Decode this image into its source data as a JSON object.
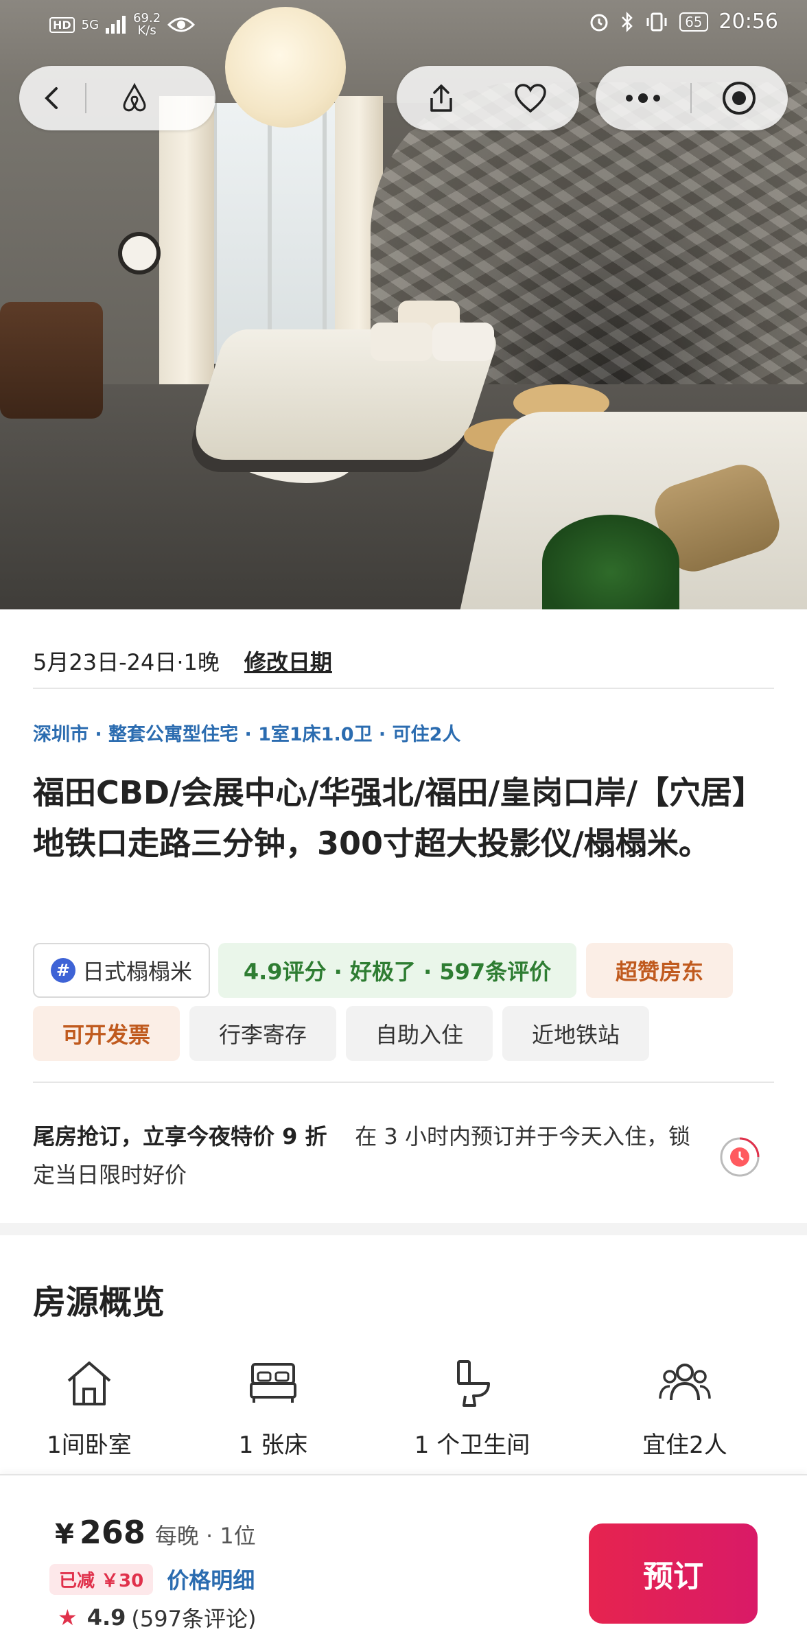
{
  "status_bar": {
    "network": "HD",
    "signal": "5G",
    "speed_value": "69.2",
    "speed_unit": "K/s",
    "battery": "65",
    "time": "20:56"
  },
  "nav": {
    "back_icon": "chevron-left-icon",
    "brand_icon": "airbnb-logo-icon",
    "share_icon": "share-icon",
    "favorite_icon": "heart-icon",
    "more_icon": "more-dots-icon",
    "target_icon": "target-icon"
  },
  "booking": {
    "dates": "5月23日-24日·1晚",
    "change_dates_label": "修改日期"
  },
  "listing": {
    "meta": "深圳市 · 整套公寓型住宅 · 1室1床1.0卫 · 可住2人",
    "title": "福田CBD/会展中心/华强北/福田/皇岗口岸/【穴居】地铁口走路三分钟，300寸超大投影仪/榻榻米。",
    "tags": [
      {
        "label": "日式榻榻米",
        "style": "outline"
      },
      {
        "label": "4.9评分 · 好极了 · 597条评价",
        "style": "green"
      },
      {
        "label": "超赞房东",
        "style": "orange"
      },
      {
        "label": "可开发票",
        "style": "orange"
      },
      {
        "label": "行李寄存",
        "style": "plain"
      },
      {
        "label": "自助入住",
        "style": "plain"
      },
      {
        "label": "近地铁站",
        "style": "plain"
      }
    ]
  },
  "promo": {
    "headline": "尾房抢订，立享今夜特价 9 折",
    "body": "在 3 小时内预订并于今天入住，锁定当日限时好价"
  },
  "overview": {
    "title": "房源概览",
    "items": [
      {
        "icon": "house-icon",
        "label": "1间卧室"
      },
      {
        "icon": "bed-icon",
        "label": "1 张床"
      },
      {
        "icon": "toilet-icon",
        "label": "1 个卫生间"
      },
      {
        "icon": "guests-icon",
        "label": "宜住2人"
      }
    ]
  },
  "footer": {
    "currency": "¥",
    "price": "268",
    "price_unit": "每晚 · 1位",
    "discount": "已减 ￥30",
    "price_detail_link": "价格明细",
    "rating": "4.9",
    "reviews": "(597条评论)",
    "book_label": "预订"
  },
  "colors": {
    "accent": "#E6244F",
    "link_blue": "#2B6CB0",
    "green_tag_text": "#2E7D32",
    "orange_tag_text": "#C05A1E"
  }
}
